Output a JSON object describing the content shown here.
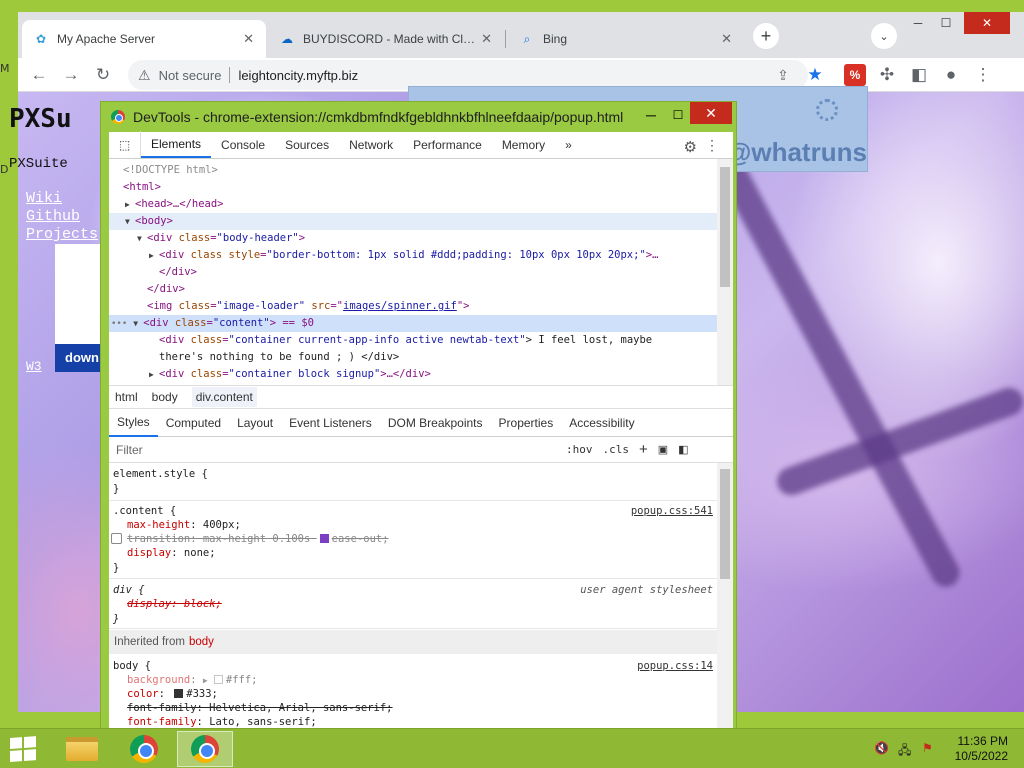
{
  "browser": {
    "tabs": [
      {
        "label": "My Apache Server",
        "icon": "apache-icon",
        "active": true
      },
      {
        "label": "BUYDISCORD - Made with Clipch",
        "icon": "cloud-icon",
        "active": false
      },
      {
        "label": "Bing",
        "icon": "search-icon",
        "active": false
      }
    ],
    "tab_close": "✕",
    "new_tab": "+",
    "tab_search": "⌄",
    "window": {
      "minimize": "─",
      "maximize": "☐",
      "close": "✕"
    },
    "nav": {
      "back": "←",
      "forward": "→",
      "reload": "↻"
    },
    "omnibox": {
      "security_icon": "⚠",
      "security_label": "Not secure",
      "url": "leightoncity.myftp.biz"
    },
    "toolbar_icons": {
      "share": "⇪",
      "bookmark": "★",
      "extension_badge": "%",
      "extensions": "✣",
      "sidepanel": "◧",
      "profile": "●",
      "menu": "⋮"
    }
  },
  "page": {
    "title_partial": "PXSu",
    "subtitle": "PXSuite",
    "links": [
      "Wiki",
      "Github",
      "Projects"
    ],
    "footer_link": "W3",
    "download_button": "down",
    "whatruns_logo": "@whatruns"
  },
  "devtools": {
    "title": "DevTools - chrome-extension://cmkdbmfndkfgebldhnkbfhlneefdaaip/popup.html",
    "title_buttons": {
      "minimize": "─",
      "maximize": "☐",
      "close": "✕"
    },
    "tabs": [
      "Elements",
      "Console",
      "Sources",
      "Network",
      "Performance",
      "Memory"
    ],
    "more_tabs": "»",
    "inspect_icon": "⬚",
    "gear": "⚙",
    "kebab": "⋮",
    "dom": {
      "l1": "<!DOCTYPE html>",
      "l2": "<html>",
      "l3": "<head>…</head>",
      "l4": "<body>",
      "l5_tag": "<div ",
      "l5_attr": "class",
      "l5_val": "\"body-header\"",
      "l5_end": ">",
      "l6_tag": "<div ",
      "l6_attr1": "class style",
      "l6_val": "\"border-bottom: 1px solid #ddd;padding: 10px 0px 10px 20px;\"",
      "l6_end": ">…",
      "l7": "</div>",
      "l8": "</div>",
      "l9_tag": "<img ",
      "l9_attr1": "class",
      "l9_val1": "\"image-loader\"",
      "l9_attr2": "src",
      "l9_val2": "images/spinner.gif",
      "l9_end": "\">",
      "l10_dots": "•••",
      "l10_tag": "<div ",
      "l10_attr": "class",
      "l10_val": "\"content\"",
      "l10_end": "> == $0",
      "l11_tag": "<div ",
      "l11_attr": "class",
      "l11_val": "\"container current-app-info active newtab-text\"",
      "l11_text": "> I feel lost, maybe",
      "l12_text": "there's nothing to be found ; ) </div>",
      "l13_tag": "<div ",
      "l13_attr": "class",
      "l13_val": "\"container block signup\"",
      "l13_end": ">…</div>"
    },
    "breadcrumbs": [
      "html",
      "body",
      "div.content"
    ],
    "subtabs": [
      "Styles",
      "Computed",
      "Layout",
      "Event Listeners",
      "DOM Breakpoints",
      "Properties",
      "Accessibility"
    ],
    "filter_placeholder": "Filter",
    "filter_tools": {
      "hov": ":hov",
      "cls": ".cls",
      "add": "+",
      "paint": "▣",
      "toggle": "◧"
    },
    "styles": {
      "element_selector": "element.style {",
      "close_brace": "}",
      "content_selector": ".content {",
      "content_src": "popup.css:541",
      "content_p1_name": "max-height",
      "content_p1_val": "400px;",
      "content_p2": "transition: max-height 0.100s ",
      "content_p2_end": "ease-out;",
      "content_p3_name": "display",
      "content_p3_val": "none;",
      "div_selector": "div {",
      "div_src": "user agent stylesheet",
      "div_p1": "display: block;",
      "inherited_label": "Inherited from",
      "inherited_from": "body",
      "body_selector": "body {",
      "body_src": "popup.css:14",
      "body_p1_name": "background",
      "body_p1_val": "#fff;",
      "body_p2_name": "color",
      "body_p2_val": "#333;",
      "body_p3": "font-family: Helvetica, Arial, sans-serif;",
      "body_p4_name": "font-family",
      "body_p4_val": "Lato, sans-serif;"
    }
  },
  "taskbar": {
    "clock_time": "11:36 PM",
    "clock_date": "10/5/2022",
    "tray": {
      "volume": "🔇",
      "network": "🖧",
      "flag": "⚑"
    },
    "desktop_edge_letters": [
      "M",
      "D"
    ]
  }
}
